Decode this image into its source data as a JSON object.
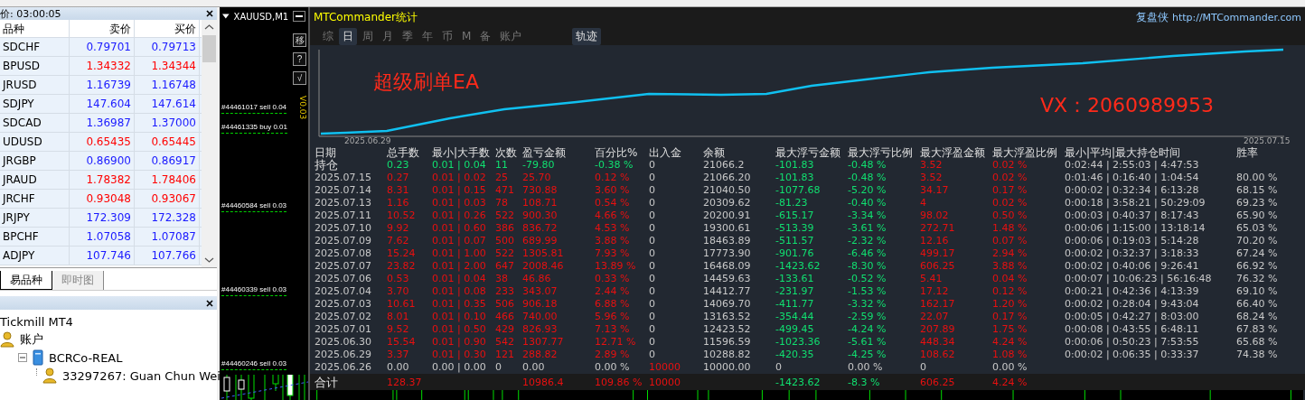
{
  "market_watch": {
    "title": "价: 03:00:05",
    "columns": [
      "品种",
      "卖价",
      "买价"
    ],
    "rows": [
      {
        "symbol": "SDCHF",
        "bid": "0.79701",
        "ask": "0.79713",
        "color": "#1a1aff"
      },
      {
        "symbol": "BPUSD",
        "bid": "1.34332",
        "ask": "1.34344",
        "color": "#ff0000"
      },
      {
        "symbol": "JRUSD",
        "bid": "1.16739",
        "ask": "1.16748",
        "color": "#1a1aff"
      },
      {
        "symbol": "SDJPY",
        "bid": "147.604",
        "ask": "147.614",
        "color": "#1a1aff"
      },
      {
        "symbol": "SDCAD",
        "bid": "1.36987",
        "ask": "1.37000",
        "color": "#1a1aff"
      },
      {
        "symbol": "UDUSD",
        "bid": "0.65435",
        "ask": "0.65445",
        "color": "#ff0000"
      },
      {
        "symbol": "JRGBP",
        "bid": "0.86900",
        "ask": "0.86917",
        "color": "#1a1aff"
      },
      {
        "symbol": "JRAUD",
        "bid": "1.78382",
        "ask": "1.78406",
        "color": "#ff0000"
      },
      {
        "symbol": "JRCHF",
        "bid": "0.93048",
        "ask": "0.93067",
        "color": "#ff0000"
      },
      {
        "symbol": "JRJPY",
        "bid": "172.309",
        "ask": "172.328",
        "color": "#1a1aff"
      },
      {
        "symbol": "BPCHF",
        "bid": "1.07058",
        "ask": "1.07087",
        "color": "#1a1aff"
      },
      {
        "symbol": "ADJPY",
        "bid": "107.746",
        "ask": "107.766",
        "color": "#1a1aff"
      }
    ],
    "tabs": [
      {
        "label": "易品种",
        "selected": true
      },
      {
        "label": "即时图",
        "selected": false
      }
    ]
  },
  "navigator": {
    "tree": [
      {
        "label": "Tickmill MT4",
        "children": [
          {
            "label": "账户",
            "kind": "account",
            "children": [
              {
                "label": "BCRCo-REAL",
                "kind": "server",
                "expanded": true,
                "children": [
                  {
                    "label": "33297267: Guan Chun Wei",
                    "kind": "account"
                  }
                ]
              }
            ]
          }
        ]
      }
    ]
  },
  "chart_window": {
    "title": "XAUUSD,M1",
    "side_buttons": [
      "移",
      "?",
      "√"
    ],
    "side_label": "V0.03",
    "order_lines": [
      {
        "label": "#44461017 sell 0.04"
      },
      {
        "label": "#44461335 buy 0.01"
      },
      {
        "label": "#44460584 sell 0.03"
      },
      {
        "label": "#44460339 sell 0.03"
      },
      {
        "label": "#44460246 sell 0.03"
      }
    ]
  },
  "stats_panel": {
    "title": "MTCommander统计",
    "brand": "复盘侠",
    "link": "http://MTCommander.com",
    "tabs": [
      {
        "label": "综",
        "selected": false
      },
      {
        "label": "日",
        "selected": true
      },
      {
        "label": "周",
        "selected": false
      },
      {
        "label": "月",
        "selected": false
      },
      {
        "label": "季",
        "selected": false
      },
      {
        "label": "年",
        "selected": false
      },
      {
        "label": "币",
        "selected": false
      },
      {
        "label": "M",
        "selected": false
      },
      {
        "label": "备",
        "selected": false
      },
      {
        "label": "账户",
        "selected": false
      }
    ],
    "track_toggle": {
      "label": "轨迹",
      "on": true
    },
    "equity_chart": {
      "start_date": "2025.06.29",
      "end_date": "2025.07.15",
      "overlay_title": "超级刷单EA",
      "overlay_contact": "VX：2060989953"
    },
    "table": {
      "columns": [
        "日期",
        "总手数",
        "最小|大手数",
        "次数",
        "盈亏金额",
        "百分比%",
        "出入金",
        "余额",
        "最大浮亏金额",
        "最大浮亏比例",
        "最大浮盈金额",
        "最大浮盈比例",
        "最小|平均|最大持仓时间",
        "胜率"
      ],
      "rows": [
        {
          "kind": "open",
          "cells": [
            "持仓",
            "0.23",
            "0.01 | 0.04",
            "11",
            "-79.80",
            "-0.38 %",
            "0",
            "21066.2",
            "-101.83",
            "-0.48 %",
            "3.52",
            "0.02 %",
            "0:02:44 | 2:55:03 | 4:47:53",
            null
          ]
        },
        {
          "kind": "day",
          "cells": [
            "2025.07.15",
            "0.27",
            "0.01 | 0.02",
            "25",
            "25.70",
            "0.12 %",
            "0",
            "21066.20",
            "-101.83",
            "-0.48 %",
            "3.52",
            "0.02 %",
            "0:01:46 | 0:16:40 | 1:04:54",
            "80.00 %"
          ]
        },
        {
          "kind": "day",
          "cells": [
            "2025.07.14",
            "8.31",
            "0.01 | 0.15",
            "471",
            "730.88",
            "3.60 %",
            "0",
            "21040.50",
            "-1077.68",
            "-5.20 %",
            "34.17",
            "0.17 %",
            "0:00:02 | 0:32:34 | 6:13:28",
            "68.15 %"
          ]
        },
        {
          "kind": "day",
          "cells": [
            "2025.07.13",
            "1.16",
            "0.01 | 0.03",
            "78",
            "108.71",
            "0.54 %",
            "0",
            "20309.62",
            "-81.23",
            "-0.40 %",
            "4",
            "0.02 %",
            "0:00:18 | 3:58:21 | 50:29:09",
            "69.23 %"
          ]
        },
        {
          "kind": "day",
          "cells": [
            "2025.07.11",
            "10.52",
            "0.01 | 0.26",
            "522",
            "900.30",
            "4.66 %",
            "0",
            "20200.91",
            "-615.17",
            "-3.34 %",
            "98.02",
            "0.50 %",
            "0:00:03 | 0:40:37 | 8:17:43",
            "65.90 %"
          ]
        },
        {
          "kind": "day",
          "cells": [
            "2025.07.10",
            "9.92",
            "0.01 | 0.60",
            "386",
            "836.72",
            "4.53 %",
            "0",
            "19300.61",
            "-513.39",
            "-3.61 %",
            "272.71",
            "1.48 %",
            "0:00:06 | 1:15:00 | 13:18:14",
            "65.03 %"
          ]
        },
        {
          "kind": "day",
          "cells": [
            "2025.07.09",
            "7.62",
            "0.01 | 0.07",
            "500",
            "689.99",
            "3.88 %",
            "0",
            "18463.89",
            "-511.57",
            "-2.32 %",
            "12.16",
            "0.07 %",
            "0:00:06 | 0:19:03 | 5:14:28",
            "70.20 %"
          ]
        },
        {
          "kind": "day",
          "cells": [
            "2025.07.08",
            "15.24",
            "0.01 | 1.00",
            "522",
            "1305.81",
            "7.93 %",
            "0",
            "17773.90",
            "-901.76",
            "-6.46 %",
            "499.17",
            "2.94 %",
            "0:00:02 | 0:32:37 | 3:18:33",
            "67.24 %"
          ]
        },
        {
          "kind": "day",
          "cells": [
            "2025.07.07",
            "23.82",
            "0.01 | 2.00",
            "647",
            "2008.46",
            "13.89 %",
            "0",
            "16468.09",
            "-1423.62",
            "-8.30 %",
            "606.25",
            "3.88 %",
            "0:00:02 | 0:40:06 | 9:26:41",
            "66.92 %"
          ]
        },
        {
          "kind": "day",
          "cells": [
            "2025.07.06",
            "0.53",
            "0.01 | 0.04",
            "38",
            "46.86",
            "0.33 %",
            "0",
            "14459.63",
            "-133.61",
            "-0.52 %",
            "5.41",
            "0.04 %",
            "0:00:07 | 10:06:23 | 56:16:48",
            "76.32 %"
          ]
        },
        {
          "kind": "day",
          "cells": [
            "2025.07.04",
            "3.70",
            "0.01 | 0.08",
            "233",
            "343.07",
            "2.44 %",
            "0",
            "14412.77",
            "-231.97",
            "-1.53 %",
            "17.12",
            "0.12 %",
            "0:00:21 | 0:42:36 | 4:13:39",
            "69.10 %"
          ]
        },
        {
          "kind": "day",
          "cells": [
            "2025.07.03",
            "10.61",
            "0.01 | 0.35",
            "506",
            "906.18",
            "6.88 %",
            "0",
            "14069.70",
            "-411.77",
            "-3.32 %",
            "162.17",
            "1.20 %",
            "0:00:02 | 0:28:04 | 9:43:04",
            "66.40 %"
          ]
        },
        {
          "kind": "day",
          "cells": [
            "2025.07.02",
            "8.01",
            "0.01 | 0.10",
            "466",
            "740.00",
            "5.96 %",
            "0",
            "13163.52",
            "-354.44",
            "-2.59 %",
            "22.07",
            "0.17 %",
            "0:00:05 | 0:42:27 | 8:03:00",
            "68.24 %"
          ]
        },
        {
          "kind": "day",
          "cells": [
            "2025.07.01",
            "9.52",
            "0.01 | 0.50",
            "429",
            "826.93",
            "7.13 %",
            "0",
            "12423.52",
            "-499.45",
            "-4.24 %",
            "207.89",
            "1.75 %",
            "0:00:08 | 0:43:55 | 6:48:11",
            "67.83 %"
          ]
        },
        {
          "kind": "day",
          "cells": [
            "2025.06.30",
            "15.54",
            "0.01 | 0.90",
            "542",
            "1307.77",
            "12.71 %",
            "0",
            "11596.59",
            "-1023.36",
            "-5.61 %",
            "448.34",
            "4.24 %",
            "0:00:06 | 0:50:23 | 7:53:55",
            "65.68 %"
          ]
        },
        {
          "kind": "day",
          "cells": [
            "2025.06.29",
            "3.37",
            "0.01 | 0.30",
            "121",
            "288.82",
            "2.89 %",
            "0",
            "10288.82",
            "-420.35",
            "-4.25 %",
            "108.62",
            "1.08 %",
            "0:00:02 | 0:06:35 | 0:33:37",
            "74.38 %"
          ]
        },
        {
          "kind": "initial",
          "cells": [
            "2025.06.26",
            "0.00",
            "0.00 | 0.00",
            "0",
            "0.00",
            "0.00 %",
            "10000",
            "10000.00",
            "0",
            "0.00 %",
            "0",
            "0.00 %",
            null,
            null
          ]
        },
        {
          "kind": "total",
          "cells": [
            "合计",
            "128.37",
            null,
            null,
            "10986.4",
            "109.86 %",
            "10000",
            null,
            "-1423.62",
            "-8.3 %",
            "606.25",
            "4.24 %",
            null,
            null
          ]
        }
      ]
    }
  }
}
